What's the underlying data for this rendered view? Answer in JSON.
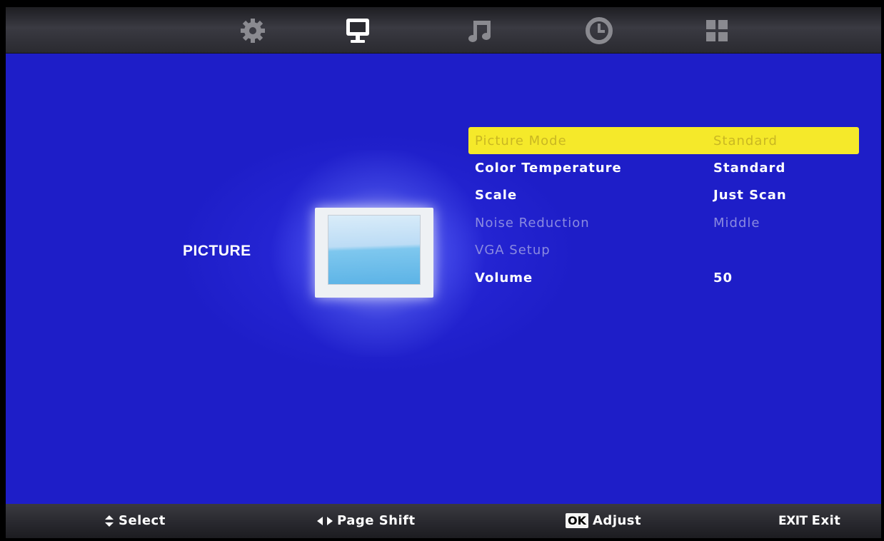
{
  "tabs": [
    {
      "id": "setup",
      "icon": "gear-icon",
      "selected": false
    },
    {
      "id": "picture",
      "icon": "monitor-icon",
      "selected": true
    },
    {
      "id": "sound",
      "icon": "music-note-icon",
      "selected": false
    },
    {
      "id": "time",
      "icon": "clock-icon",
      "selected": false
    },
    {
      "id": "apps",
      "icon": "grid-icon",
      "selected": false
    }
  ],
  "category": {
    "title": "PICTURE",
    "icon": "picture-icon"
  },
  "menu": {
    "items": [
      {
        "label": "Picture Mode",
        "value": "Standard",
        "state": "selected"
      },
      {
        "label": "Color Temperature",
        "value": "Standard",
        "state": "active"
      },
      {
        "label": "Scale",
        "value": "Just Scan",
        "state": "active"
      },
      {
        "label": "Noise Reduction",
        "value": "Middle",
        "state": "disabled"
      },
      {
        "label": "VGA Setup",
        "value": "",
        "state": "disabled"
      },
      {
        "label": "Volume",
        "value": "50",
        "state": "active"
      }
    ]
  },
  "hints": {
    "select": {
      "icon": "up-down-arrows-icon",
      "label": "Select"
    },
    "page_shift": {
      "icon": "left-right-arrows-icon",
      "label": "Page Shift"
    },
    "adjust": {
      "key": "OK",
      "label": "Adjust"
    },
    "exit": {
      "key": "EXIT",
      "label": "Exit"
    }
  },
  "colors": {
    "background": "#2222cc",
    "highlight": "#f5e92a",
    "highlight_text": "#c9b722",
    "active_text": "#ffffff",
    "disabled_text": "#8a8ae0"
  }
}
